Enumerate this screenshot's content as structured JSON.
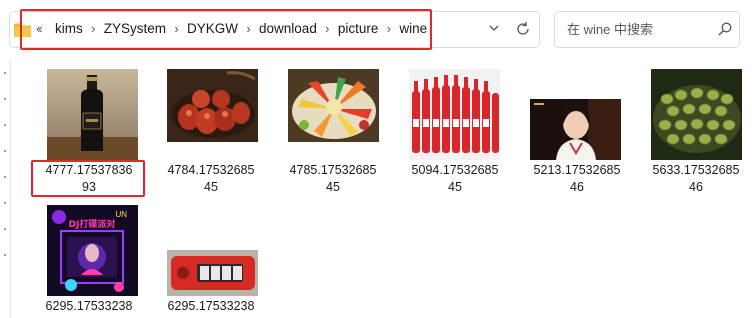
{
  "address_bar": {
    "overflow_icon": "double-chevron-left-icon",
    "path": [
      "kims",
      "ZYSystem",
      "DYKGW",
      "download",
      "picture",
      "wine"
    ],
    "separator": "›"
  },
  "search": {
    "placeholder": "在 wine 中搜索",
    "value": ""
  },
  "files": [
    {
      "name_line1": "4777.17537836",
      "name_line2": "93",
      "thumb": "dark-whisky-bottle-image",
      "selected": true
    },
    {
      "name_line1": "4784.17532685",
      "name_line2": "45",
      "thumb": "grilled-sausages-image",
      "selected": false
    },
    {
      "name_line1": "4785.17532685",
      "name_line2": "45",
      "thumb": "fruit-platter-image",
      "selected": false
    },
    {
      "name_line1": "5094.17532685",
      "name_line2": "45",
      "thumb": "red-beer-bottles-image",
      "selected": false
    },
    {
      "name_line1": "5213.17532685",
      "name_line2": "46",
      "thumb": "woman-portrait-image",
      "selected": false
    },
    {
      "name_line1": "5633.17532685",
      "name_line2": "46",
      "thumb": "green-beans-image",
      "selected": false
    },
    {
      "name_line1": "6295.17533238",
      "name_line2": "",
      "thumb": "dj-party-poster-image",
      "selected": false
    },
    {
      "name_line1": "6295.17533238",
      "name_line2": "",
      "thumb": "red-combination-lock-image",
      "selected": false
    }
  ],
  "poster_text": {
    "top": "UN",
    "title": "DJ打碟派对"
  },
  "colors": {
    "highlight": "#e0282d",
    "folder": "#f2b938"
  }
}
